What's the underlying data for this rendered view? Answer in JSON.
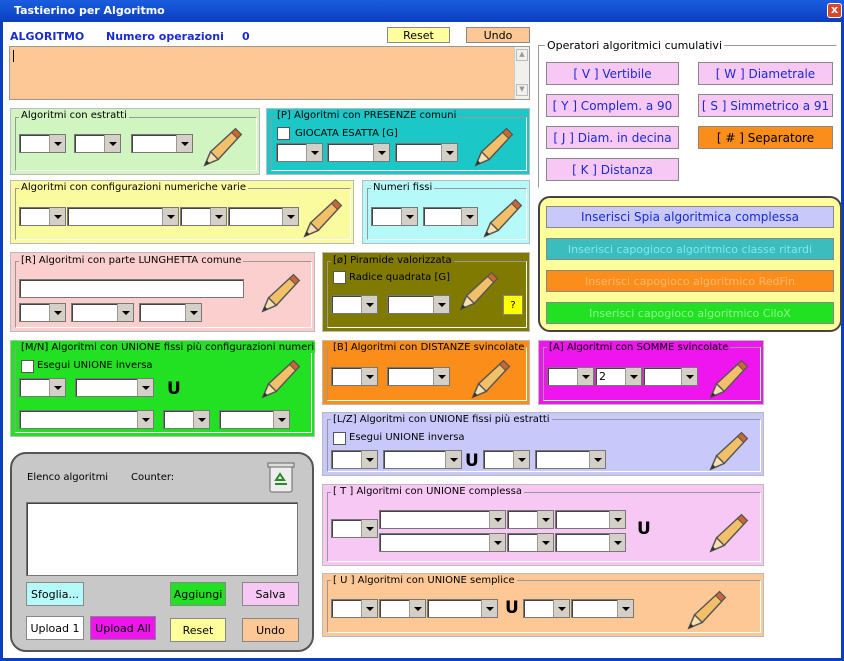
{
  "window": {
    "title": "Tastierino per Algoritmo",
    "close_glyph": "x"
  },
  "header": {
    "algo_label": "ALGORITMO",
    "ops_label": "Numero operazioni",
    "ops_count": "0",
    "reset": "Reset",
    "undo": "Undo"
  },
  "cumulative": {
    "title": "Operatori algoritmici cumulativi",
    "buttons": [
      "[ V ] Vertibile",
      "[ W ] Diametrale",
      "[ Y ] Complem. a 90",
      "[ S ] Simmetrico  a 91",
      "[ J ] Diam. in decina",
      "[ # ] Separatore",
      "[ K ] Distanza"
    ]
  },
  "capogioco": {
    "buttons": [
      "Inserisci Spia algoritmica complessa",
      "Inserisci capogioco algoritmico classe ritardi",
      "Inserisci capogioco algoritmico RedFin",
      "Inserisci capogioco algoritmico CiloX"
    ]
  },
  "panels": {
    "estratti": "Algoritmi con estratti",
    "presenze": "[P] Algoritmi con PRESENZE comuni",
    "giocata": "GIOCATA ESATTA  [G]",
    "config": "Algoritmi con configurazioni numeriche varie",
    "fissi": "Numeri fissi",
    "lunghetta": "[R] Algoritmi con parte LUNGHETTA comune",
    "piramide": "[ø] Piramide valorizzata",
    "radice": "Radice quadrata  [G]",
    "piramide_q": "?",
    "unione_mn": "[M/N] Algoritmi con UNIONE fissi più configurazioni numeri vari",
    "esegui": "Esegui UNIONE inversa",
    "distanze": "[B] Algoritmi con DISTANZE svincolate",
    "somme": "[A] Algoritmi con SOMME svincolate",
    "somme_val": "2",
    "unione_lz": "[L/Z] Algoritmi con UNIONE fissi più estratti",
    "unione_complessa": "[ T ] Algoritmi con UNIONE complessa",
    "unione_semplice": "[ U ] Algoritmi con UNIONE semplice",
    "U": "U"
  },
  "elenco": {
    "title": "Elenco algoritmi",
    "counter": "Counter:",
    "sfoglia": "Sfoglia...",
    "aggiungi": "Aggiungi",
    "salva": "Salva",
    "upload1": "Upload 1",
    "upload_all": "Upload All",
    "reset": "Reset",
    "undo": "Undo"
  },
  "colors": {
    "accent": "#1a2bd0",
    "titlebar": "#0a3fbf"
  }
}
